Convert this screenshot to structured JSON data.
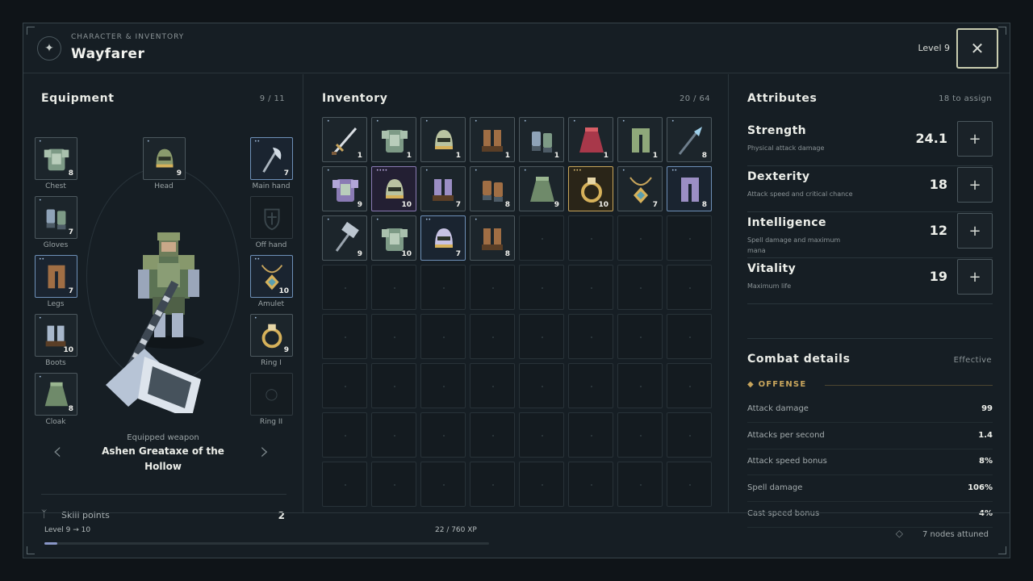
{
  "header": {
    "subtitle": "CHARACTER & INVENTORY",
    "title": "Wayfarer",
    "level": "Level 9",
    "emblem_icon": "compass-star-icon",
    "close_icon": "close-icon"
  },
  "equipment": {
    "title": "Equipment",
    "count": "9 / 11",
    "slots": [
      {
        "id": "chest",
        "label": "Chest",
        "item": "chest-armor",
        "qty": "8",
        "rarity": "common",
        "pips": "•"
      },
      {
        "id": "head",
        "label": "Head",
        "item": "helmet",
        "qty": "9",
        "rarity": "common",
        "pips": "•"
      },
      {
        "id": "main-hand",
        "label": "Main hand",
        "item": "greataxe",
        "qty": "7",
        "rarity": "rare",
        "pips": "••"
      },
      {
        "id": "gloves",
        "label": "Gloves",
        "item": "gloves",
        "qty": "7",
        "rarity": "common",
        "pips": "•"
      },
      {
        "id": "off-hand",
        "label": "Off hand",
        "item": "shield-outline",
        "qty": "",
        "rarity": "empty",
        "pips": ""
      },
      {
        "id": "legs",
        "label": "Legs",
        "item": "leggings-brown",
        "qty": "7",
        "rarity": "rare",
        "pips": "••"
      },
      {
        "id": "amulet",
        "label": "Amulet",
        "item": "amulet",
        "qty": "10",
        "rarity": "rare",
        "pips": "••"
      },
      {
        "id": "boots",
        "label": "Boots",
        "item": "boots-steel",
        "qty": "10",
        "rarity": "common",
        "pips": "•"
      },
      {
        "id": "ring-1",
        "label": "Ring I",
        "item": "ring",
        "qty": "9",
        "rarity": "common",
        "pips": "•"
      },
      {
        "id": "cloak",
        "label": "Cloak",
        "item": "cloak-green",
        "qty": "8",
        "rarity": "common",
        "pips": "•"
      },
      {
        "id": "ring-2",
        "label": "Ring II",
        "item": "ring-outline",
        "qty": "",
        "rarity": "empty",
        "pips": ""
      }
    ],
    "weapon_caption": "Equipped weapon",
    "weapon_name": "Ashen Greataxe of the Hollow",
    "prev_label": "‹",
    "next_label": "›",
    "skill_icon": "skill-tree-icon",
    "skill_label": "Skill points",
    "skill_value": "2"
  },
  "inventory": {
    "title": "Inventory",
    "count": "20 / 64",
    "items": [
      {
        "item": "sword",
        "qty": "1",
        "rarity": "common",
        "pips": "•"
      },
      {
        "item": "chest-armor",
        "qty": "1",
        "rarity": "common",
        "pips": "•"
      },
      {
        "item": "helmet-gold",
        "qty": "1",
        "rarity": "common",
        "pips": "•"
      },
      {
        "item": "boots-brown",
        "qty": "1",
        "rarity": "common",
        "pips": "•"
      },
      {
        "item": "gloves",
        "qty": "1",
        "rarity": "common",
        "pips": "•"
      },
      {
        "item": "cloak-red",
        "qty": "1",
        "rarity": "common",
        "pips": "•"
      },
      {
        "item": "leggings-green",
        "qty": "1",
        "rarity": "common",
        "pips": "•"
      },
      {
        "item": "spear",
        "qty": "8",
        "rarity": "common",
        "pips": "•"
      },
      {
        "item": "chest-purple",
        "qty": "9",
        "rarity": "common",
        "pips": "•"
      },
      {
        "item": "helmet-gold",
        "qty": "10",
        "rarity": "epic",
        "pips": "••••"
      },
      {
        "item": "boots-purple",
        "qty": "7",
        "rarity": "common",
        "pips": "•"
      },
      {
        "item": "gloves-brown",
        "qty": "8",
        "rarity": "common",
        "pips": "•"
      },
      {
        "item": "cloak-green",
        "qty": "9",
        "rarity": "common",
        "pips": "•"
      },
      {
        "item": "ring-gold",
        "qty": "10",
        "rarity": "legendary",
        "pips": "•••"
      },
      {
        "item": "amulet",
        "qty": "7",
        "rarity": "common",
        "pips": "•"
      },
      {
        "item": "leggings-purple",
        "qty": "8",
        "rarity": "rare",
        "pips": "••"
      },
      {
        "item": "hammer",
        "qty": "9",
        "rarity": "common",
        "pips": "•"
      },
      {
        "item": "chest-armor",
        "qty": "10",
        "rarity": "common",
        "pips": "•"
      },
      {
        "item": "helmet-purple",
        "qty": "7",
        "rarity": "rare",
        "pips": "••"
      },
      {
        "item": "boots-brown",
        "qty": "8",
        "rarity": "common",
        "pips": "•"
      }
    ],
    "capacity": 64
  },
  "attributes": {
    "title": "Attributes",
    "to_assign": "18 to assign",
    "list": [
      {
        "name": "Strength",
        "desc": "Physical attack damage",
        "value": "24.1",
        "btn": "+"
      },
      {
        "name": "Dexterity",
        "desc": "Attack speed and critical chance",
        "value": "18",
        "btn": "+"
      },
      {
        "name": "Intelligence",
        "desc": "Spell damage and maximum mana",
        "value": "12",
        "btn": "+"
      },
      {
        "name": "Vitality",
        "desc": "Maximum life",
        "value": "19",
        "btn": "+"
      }
    ]
  },
  "combat": {
    "title": "Combat details",
    "mode": "Effective",
    "group": "◆ OFFENSE",
    "stats": [
      {
        "label": "Attack damage",
        "value": "99"
      },
      {
        "label": "Attacks per second",
        "value": "1.4"
      },
      {
        "label": "Attack speed bonus",
        "value": "8%"
      },
      {
        "label": "Spell damage",
        "value": "106%"
      },
      {
        "label": "Cast speed bonus",
        "value": "4%"
      }
    ]
  },
  "footer": {
    "level_progress": "Level 9 → 10",
    "xp_text": "22 / 760 XP",
    "xp_fraction": 0.029,
    "nodes_icon": "diamond-node-icon",
    "nodes_text": "7 nodes attuned"
  },
  "colors": {
    "accent_gold": "#c8a55c",
    "rare_blue": "#6e90b8",
    "epic_purple": "#8a7bb4",
    "legendary_gold": "#c7a55a",
    "xp_bar": "#8a97c8"
  }
}
